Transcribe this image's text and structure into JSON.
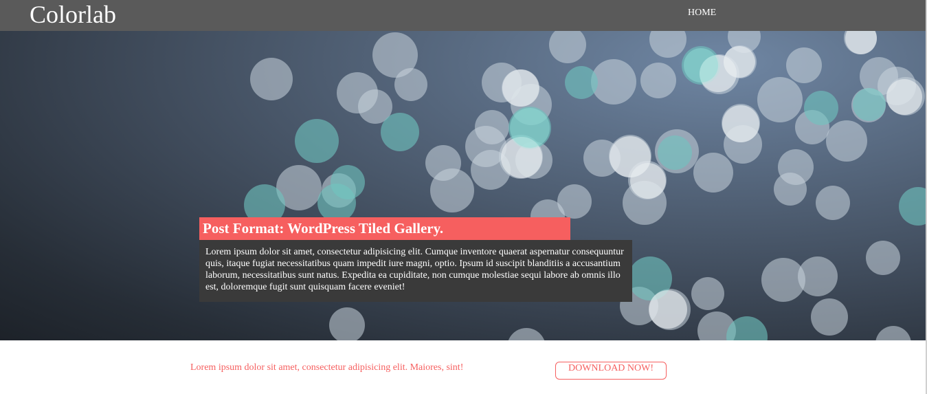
{
  "header": {
    "logo": "Colorlab",
    "nav": [
      {
        "label": "HOME"
      }
    ]
  },
  "hero": {
    "post_title": "Post Format: WordPress Tiled Gallery.",
    "post_excerpt": "Lorem ipsum dolor sit amet, consectetur adipisicing elit. Cumque inventore quaerat aspernatur consequuntur quis, itaque fugiat necessitatibus quam impedit iure magni, optio. Ipsum id suscipit blanditiis a accusantium laborum, necessitatibus sunt natus. Expedita ea cupiditate, non cumque molestiae sequi labore ab omnis illo est, doloremque fugit sunt quisquam facere eveniet!"
  },
  "cta": {
    "text": "Lorem ipsum dolor sit amet, consectetur adipisicing elit. Maiores, sint!",
    "button_label": "DOWNLOAD NOW!"
  },
  "colors": {
    "header_bg": "#5a5a5a",
    "accent": "#f65f5f",
    "excerpt_bg": "#3a3a3a"
  }
}
